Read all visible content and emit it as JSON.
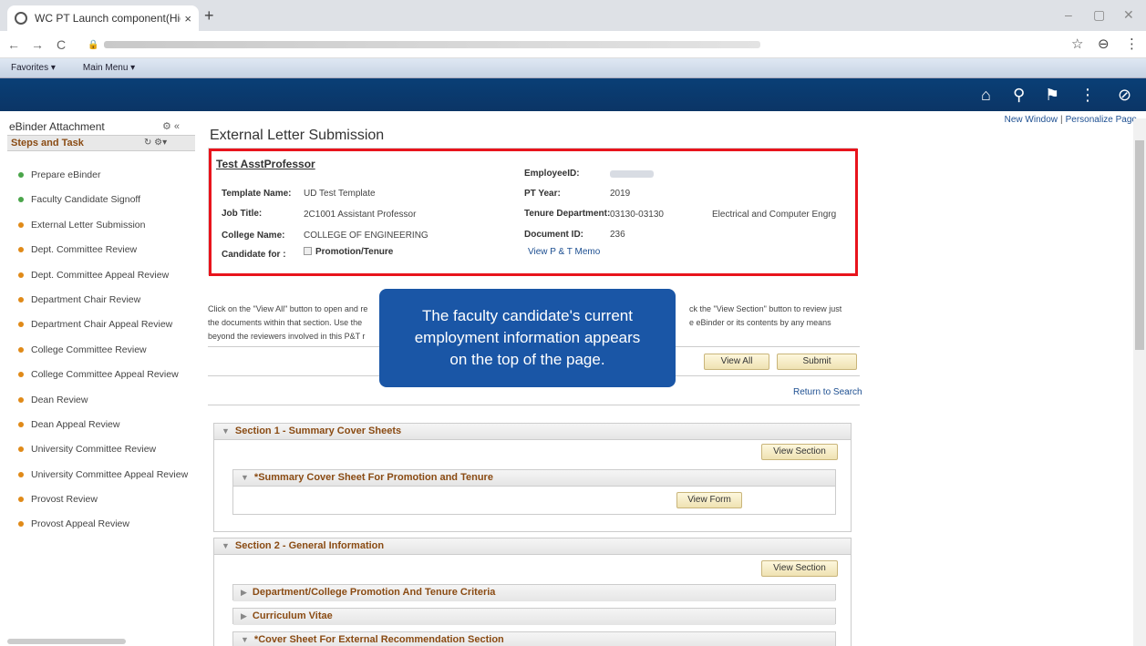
{
  "browser": {
    "tab_title": "WC PT Launch component(Hidde",
    "tab_close": "×",
    "new_tab": "+",
    "win_min": "–",
    "win_max": "▢",
    "win_close": "✕",
    "back": "←",
    "forward": "→",
    "reload": "C",
    "star": "☆",
    "menu": "⋮",
    "profile": "⊖",
    "lock": "🔒"
  },
  "favbar": {
    "favorites": "Favorites ▾",
    "main_menu": "Main Menu ▾"
  },
  "header_icons": {
    "home": "⌂",
    "search": "⚲",
    "flag": "⚑",
    "more": "⋮",
    "nav": "⊘"
  },
  "toplinks": {
    "new_window": "New Window",
    "separator": "|",
    "personalize": "Personalize Page"
  },
  "left": {
    "title": "eBinder Attachment",
    "title_icons": "⚙ «",
    "subtitle": "Steps and Task",
    "sub_icons": "↻ ⚙▾",
    "steps": [
      {
        "label": "Prepare eBinder",
        "status": "done"
      },
      {
        "label": "Faculty Candidate Signoff",
        "status": "done"
      },
      {
        "label": "External Letter Submission",
        "status": "todo"
      },
      {
        "label": "Dept. Committee Review",
        "status": "todo"
      },
      {
        "label": "Dept. Committee Appeal Review",
        "status": "todo"
      },
      {
        "label": "Department Chair Review",
        "status": "todo"
      },
      {
        "label": "Department Chair Appeal Review",
        "status": "todo"
      },
      {
        "label": "College Committee Review",
        "status": "todo"
      },
      {
        "label": "College Committee Appeal Review",
        "status": "todo"
      },
      {
        "label": "Dean Review",
        "status": "todo"
      },
      {
        "label": "Dean Appeal Review",
        "status": "todo"
      },
      {
        "label": "University Committee Review",
        "status": "todo"
      },
      {
        "label": "University Committee Appeal Review",
        "status": "todo"
      },
      {
        "label": "Provost Review",
        "status": "todo"
      },
      {
        "label": "Provost Appeal Review",
        "status": "todo"
      }
    ]
  },
  "main": {
    "page_title": "External Letter Submission",
    "employee": {
      "name": "Test AsstProfessor",
      "template_label": "Template Name:",
      "template_value": "UD Test Template",
      "job_label": "Job Title:",
      "job_value": "2C1001  Assistant Professor",
      "college_label": "College Name:",
      "college_value": "COLLEGE OF ENGINEERING",
      "candidate_label": "Candidate for :",
      "candidate_value": "Promotion/Tenure",
      "empid_label": "EmployeeID:",
      "ptyear_label": "PT Year:",
      "ptyear_value": "2019",
      "tenure_label": "Tenure Department:",
      "tenure_code": "03130-03130",
      "tenure_dept": "Electrical and Computer Engrg",
      "docid_label": "Document ID:",
      "docid_value": "236",
      "memo_link": "View P & T Memo"
    },
    "instructions": [
      "Click on the \"View All\" button to open and re",
      "ck the \"View Section\" button to review just",
      "the documents within that section. Use the",
      "e eBinder or its contents by any means",
      "beyond the reviewers involved in this P&T r"
    ],
    "view_all": "View All",
    "submit": "Submit",
    "return_link": "Return to Search",
    "view_section": "View Section",
    "view_form": "View Form",
    "sections": {
      "s1": "Section 1 - Summary Cover Sheets",
      "s1_sub": "*Summary Cover Sheet For Promotion and Tenure",
      "s2": "Section 2 - General Information",
      "s2_sub1": "Department/College Promotion And Tenure Criteria",
      "s2_sub2": "Curriculum Vitae",
      "s2_sub3": "*Cover Sheet For External Recommendation Section"
    }
  },
  "tooltip": {
    "line1": "The faculty candidate's current",
    "line2": "employment information appears",
    "line3": "on the top of the page."
  }
}
